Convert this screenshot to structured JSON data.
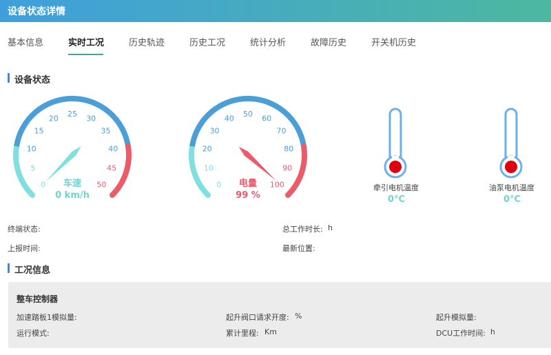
{
  "window": {
    "title": "设备状态详情"
  },
  "tabs": [
    {
      "label": "基本信息",
      "active": false
    },
    {
      "label": "实时工况",
      "active": true
    },
    {
      "label": "历史轨迹",
      "active": false
    },
    {
      "label": "历史工况",
      "active": false
    },
    {
      "label": "统计分析",
      "active": false
    },
    {
      "label": "故障历史",
      "active": false
    },
    {
      "label": "开关机历史",
      "active": false
    }
  ],
  "device_status": {
    "section_title": "设备状态",
    "speed_gauge": {
      "name": "车速",
      "value_text": "0 km/h",
      "value": 0,
      "min": 0,
      "max": 50,
      "ticks": [
        "0",
        "5",
        "10",
        "15",
        "20",
        "25",
        "30",
        "35",
        "40",
        "45",
        "50"
      ],
      "color_main": "#4a9fd8",
      "color_low": "#7fe0dd",
      "color_high": "#ec5b6a",
      "name_color": "#6fd4d0",
      "needle_color": "#7fe0dd"
    },
    "battery_gauge": {
      "name": "电量",
      "value_text": "99 %",
      "value": 99,
      "min": 0,
      "max": 100,
      "ticks": [
        "0",
        "10",
        "20",
        "30",
        "40",
        "50",
        "60",
        "70",
        "80",
        "90",
        "100"
      ],
      "color_main": "#4a9fd8",
      "color_low": "#7fe0dd",
      "color_high": "#ec5b6a",
      "name_color": "#ec5b6a",
      "needle_color": "#ec5b6a"
    },
    "thermometers": [
      {
        "label": "牵引电机温度",
        "value": "0°C"
      },
      {
        "label": "油泵电机温度",
        "value": "0°C"
      }
    ],
    "info": {
      "terminal_status_label": "终端状态:",
      "total_work_time_label": "总工作时长:",
      "total_work_time_unit": "h",
      "report_time_label": "上报时间:",
      "latest_location_label": "最新位置:"
    }
  },
  "working_info": {
    "section_title": "工况信息",
    "panel_title": "整车控制器",
    "fields": [
      {
        "label": "加速踏板1模拟量:",
        "unit": ""
      },
      {
        "label": "起升阀口请求开度:",
        "unit": "%"
      },
      {
        "label": "起升模拟量:",
        "unit": ""
      },
      {
        "label": "运行模式:",
        "unit": ""
      },
      {
        "label": "累计里程:",
        "unit": "Km"
      },
      {
        "label": "DCU工作时间:",
        "unit": "h"
      }
    ]
  },
  "colors": {
    "accent": "#2d8cf0",
    "title_gradient_start": "#3f9fdc",
    "title_gradient_end": "#4db8a0",
    "tab_underline": "#36a9a0",
    "thermometer_tube": "#6ab0ea",
    "thermometer_bulb": "#e00012"
  }
}
